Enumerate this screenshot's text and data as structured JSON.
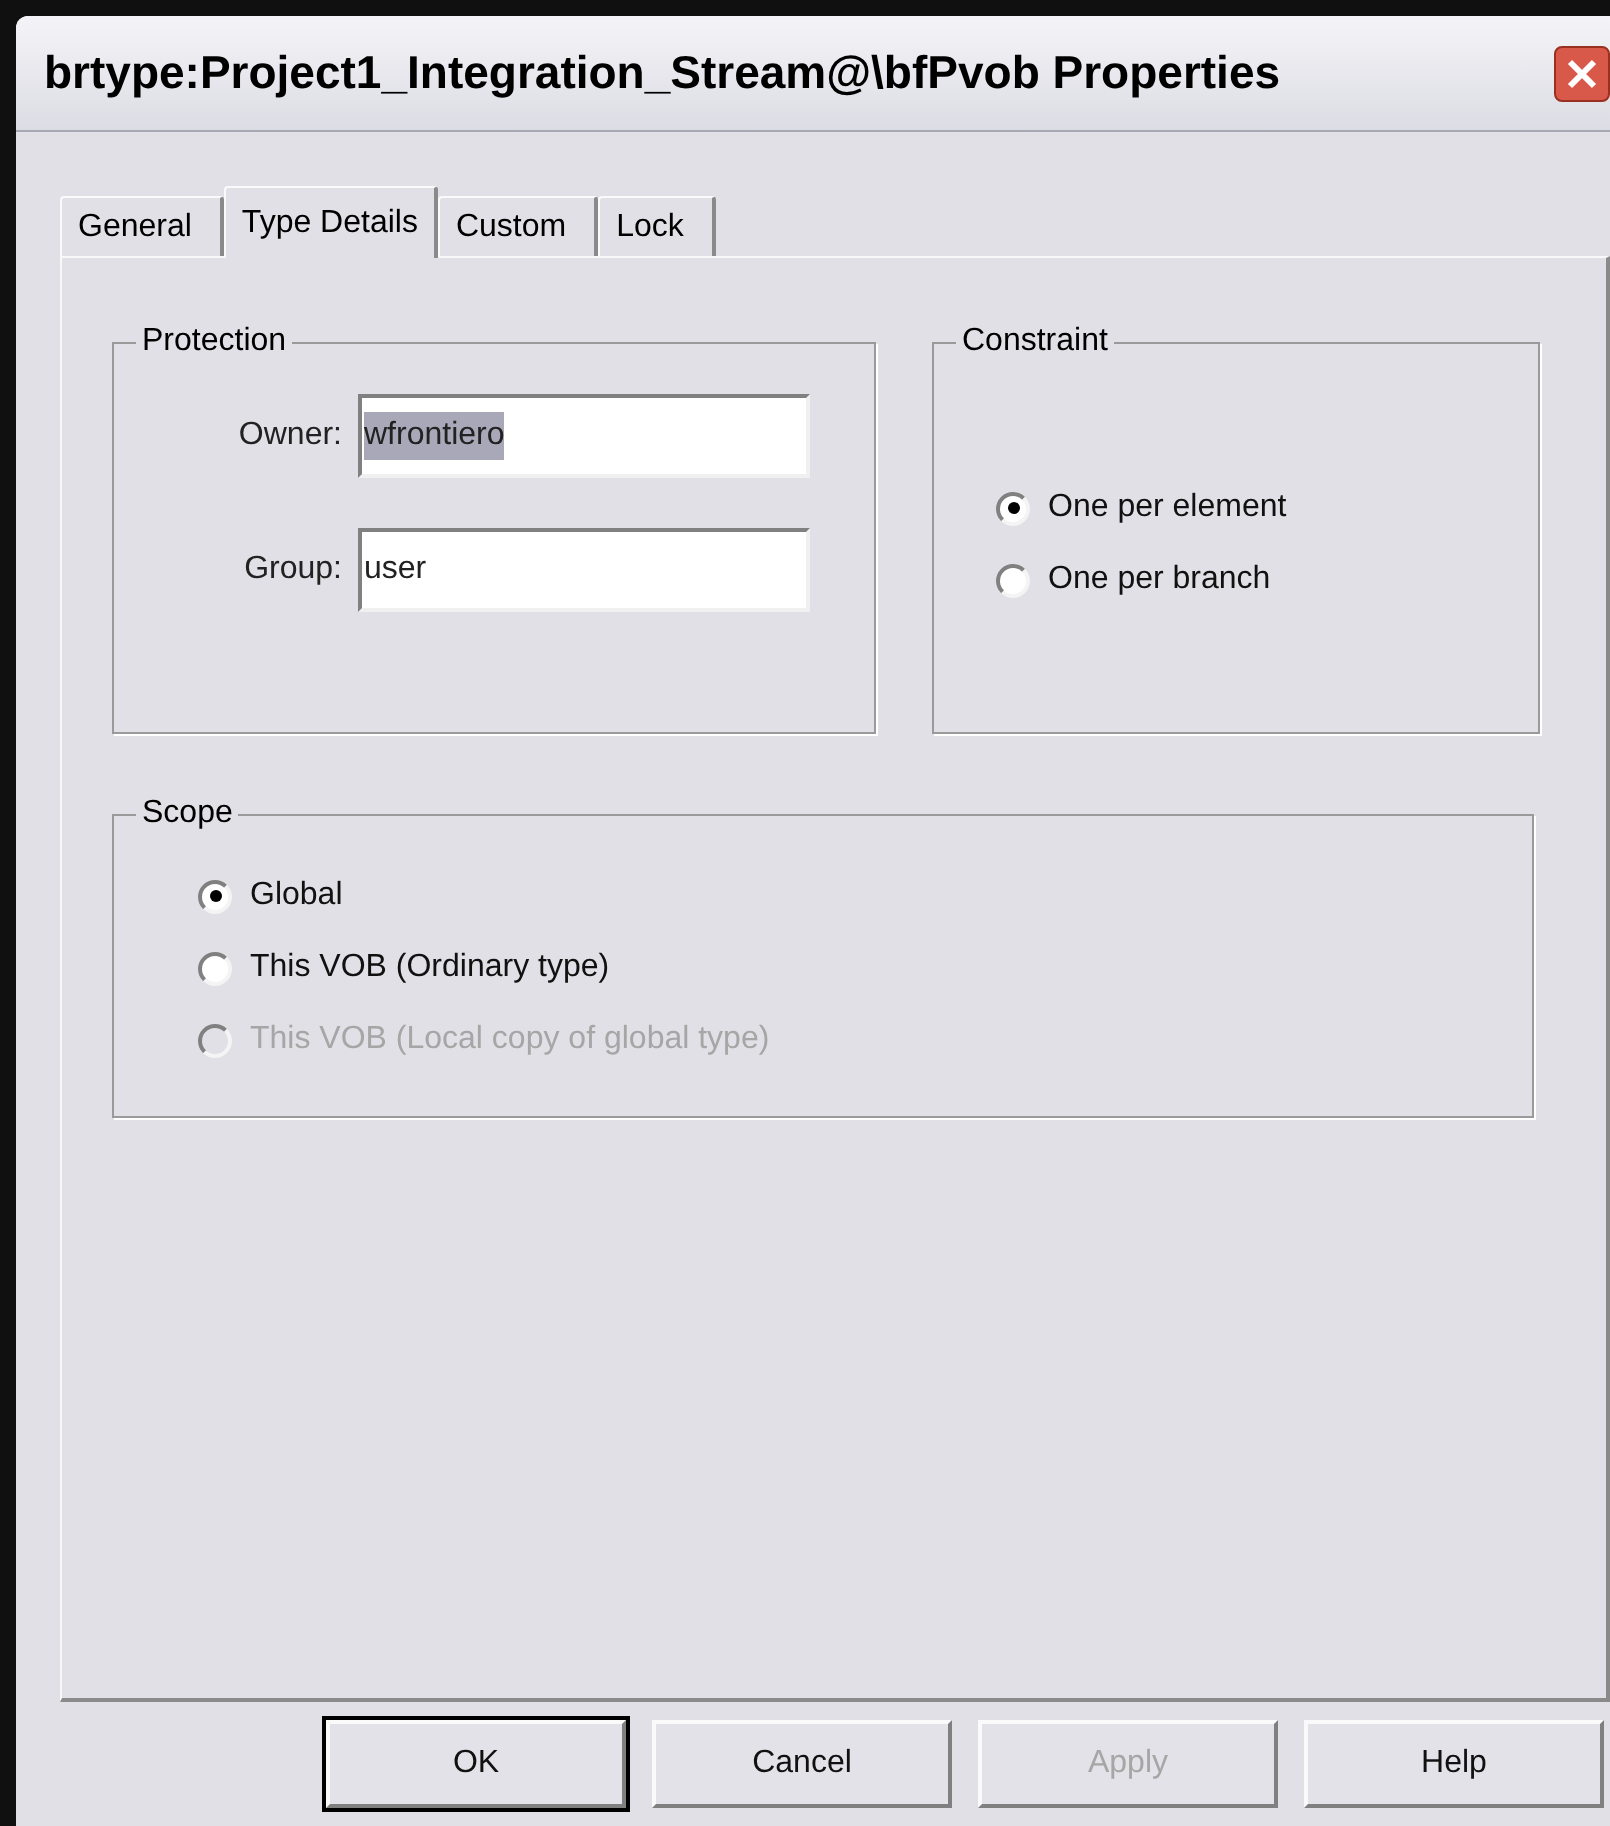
{
  "window": {
    "title": "brtype:Project1_Integration_Stream@\\bfPvob Properties"
  },
  "tabs": [
    {
      "label": "General",
      "selected": false
    },
    {
      "label": "Type Details",
      "selected": true
    },
    {
      "label": "Custom",
      "selected": false
    },
    {
      "label": "Lock",
      "selected": false
    }
  ],
  "protection": {
    "title": "Protection",
    "fields": [
      {
        "label": "Owner:",
        "value": "wfrontiero",
        "selected": true
      },
      {
        "label": "Group:",
        "value": "user",
        "selected": false
      }
    ]
  },
  "constraint": {
    "title": "Constraint",
    "options": [
      {
        "label": "One per element",
        "selected": true,
        "disabled": false
      },
      {
        "label": "One per branch",
        "selected": false,
        "disabled": false
      }
    ]
  },
  "scope": {
    "title": "Scope",
    "options": [
      {
        "label": "Global",
        "selected": true,
        "disabled": false
      },
      {
        "label": "This VOB (Ordinary type)",
        "selected": false,
        "disabled": false
      },
      {
        "label": "This VOB (Local copy of global type)",
        "selected": false,
        "disabled": true
      }
    ]
  },
  "buttons": [
    {
      "label": "OK",
      "default": true,
      "disabled": false
    },
    {
      "label": "Cancel",
      "default": false,
      "disabled": false
    },
    {
      "label": "Apply",
      "default": false,
      "disabled": true
    },
    {
      "label": "Help",
      "default": false,
      "disabled": false
    }
  ]
}
